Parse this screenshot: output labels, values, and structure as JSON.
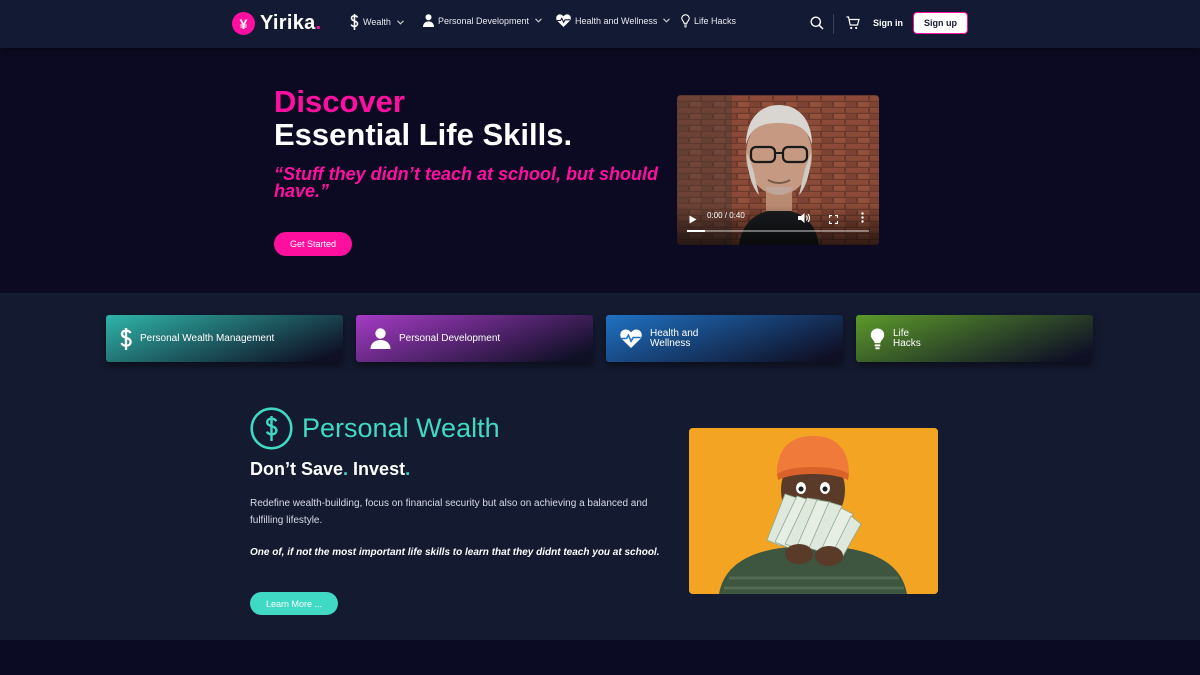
{
  "brand": {
    "logo_glyph": "¥",
    "name": "Yirika",
    "dot": ".",
    "accent_color": "#ff0fa0"
  },
  "nav": {
    "items": [
      {
        "label": "Wealth",
        "icon": "dollar-icon",
        "has_dropdown": true
      },
      {
        "label": "Personal Development",
        "icon": "user-icon",
        "has_dropdown": true
      },
      {
        "label": "Health and Wellness",
        "icon": "heartbeat-icon",
        "has_dropdown": true
      },
      {
        "label": "Life Hacks",
        "icon": "lightbulb-icon",
        "has_dropdown": false
      }
    ],
    "search_icon": "search-icon",
    "cart_icon": "cart-icon",
    "signin_label": "Sign in",
    "signup_label": "Sign up"
  },
  "hero": {
    "title_line1": "Discover",
    "title_line2": "Essential Life Skills.",
    "quote": "“Stuff they didn’t teach at school, but should have.”",
    "cta_label": "Get Started",
    "video": {
      "time": "0:00 / 0:40",
      "progress": 0.1
    }
  },
  "categories": [
    {
      "label": "Personal Wealth Management",
      "icon": "dollar-icon",
      "color": "#2fb5a8"
    },
    {
      "label": "Personal Development",
      "icon": "user-icon",
      "color": "#a63bc6"
    },
    {
      "label": "Health and\nWellness",
      "icon": "heartbeat-icon",
      "color": "#1f72c4"
    },
    {
      "label": "Life\nHacks",
      "icon": "lightbulb-icon",
      "color": "#5c9a2a"
    }
  ],
  "wealth_section": {
    "title": "Personal Wealth",
    "subtitle_part1": "Don’t Save",
    "subtitle_dot1": ".",
    "subtitle_part2": " Invest",
    "subtitle_dot2": ".",
    "description": "Redefine wealth-building, focus on financial security but also on achieving a balanced and fulfilling lifestyle.",
    "emphasis": "One of, if not the most important life skills to learn that they didnt teach you at school.",
    "cta_label": "Learn More ...",
    "accent_color": "#3fd9c4"
  }
}
